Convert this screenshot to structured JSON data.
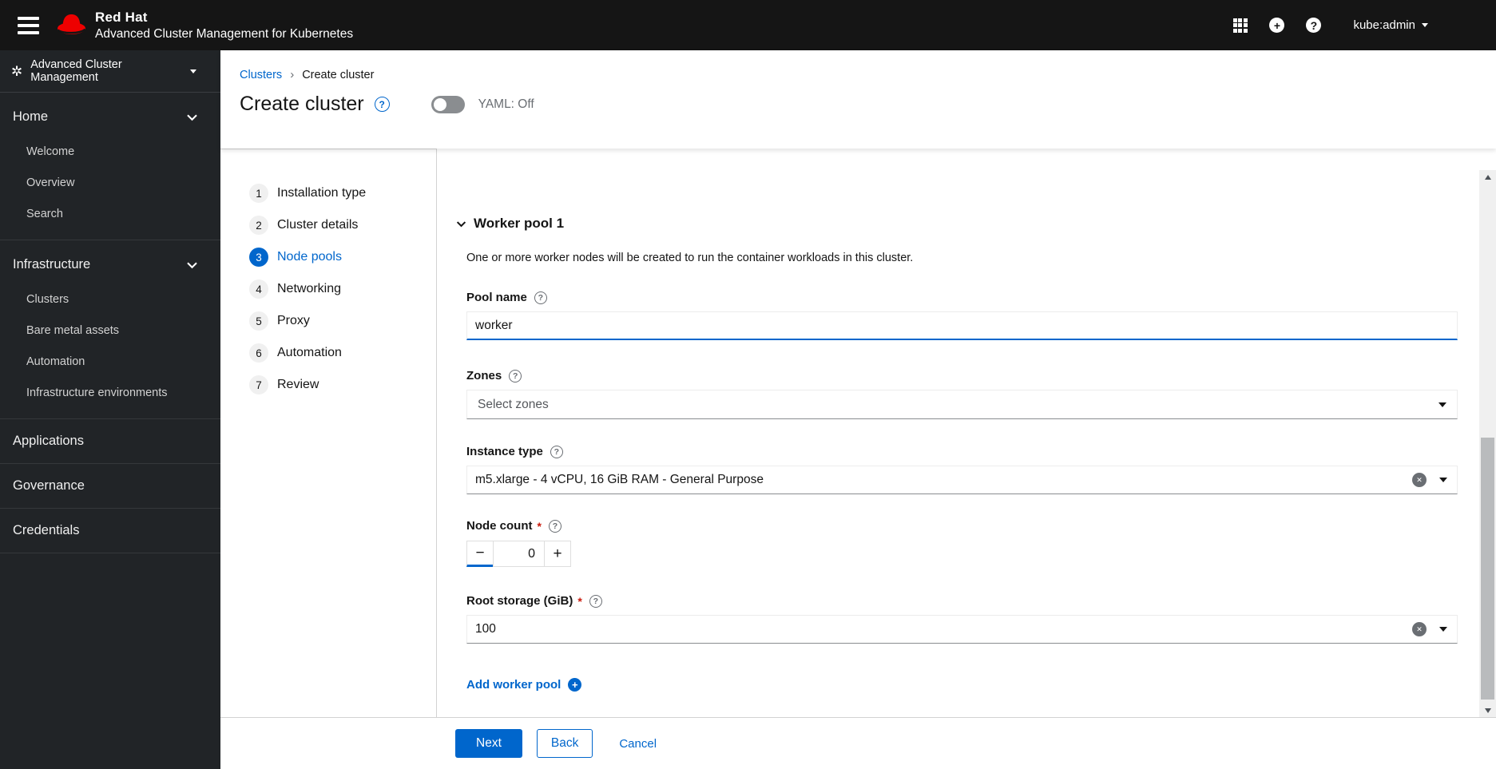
{
  "glyphs": {
    "question": "?",
    "plus": "+",
    "minus": "−",
    "clear": "✕",
    "breadcrumb_separator": "›",
    "perspective_logo": "✲"
  },
  "colors": {
    "brand_red": "#ee0000",
    "accent_blue": "#0066cc",
    "danger_red": "#c9190b",
    "masthead_bg": "#151515",
    "sidebar_bg": "#212427"
  },
  "masthead": {
    "brand_title": "Red Hat",
    "brand_subtitle": "Advanced Cluster Management for Kubernetes",
    "username": "kube:admin"
  },
  "sidebar": {
    "perspective_label": "Advanced Cluster Management",
    "sections": [
      {
        "label": "Home",
        "items": [
          "Welcome",
          "Overview",
          "Search"
        ]
      },
      {
        "label": "Infrastructure",
        "items": [
          "Clusters",
          "Bare metal assets",
          "Automation",
          "Infrastructure environments"
        ]
      },
      {
        "label": "Applications",
        "items": []
      },
      {
        "label": "Governance",
        "items": []
      },
      {
        "label": "Credentials",
        "items": []
      }
    ]
  },
  "breadcrumb": {
    "items": [
      "Clusters",
      "Create cluster"
    ]
  },
  "page_header": {
    "title": "Create cluster",
    "yaml_toggle_label": "YAML: Off"
  },
  "wizard": {
    "steps": [
      {
        "num": "1",
        "label": "Installation type"
      },
      {
        "num": "2",
        "label": "Cluster details"
      },
      {
        "num": "3",
        "label": "Node pools"
      },
      {
        "num": "4",
        "label": "Networking"
      },
      {
        "num": "5",
        "label": "Proxy"
      },
      {
        "num": "6",
        "label": "Automation"
      },
      {
        "num": "7",
        "label": "Review"
      }
    ],
    "active_step": "Node pools"
  },
  "form": {
    "section_title": "Worker pool 1",
    "section_description": "One or more worker nodes will be created to run the container workloads in this cluster.",
    "required_marker": "*",
    "pool_name": {
      "label": "Pool name",
      "value": "worker"
    },
    "zones": {
      "label": "Zones",
      "placeholder": "Select zones"
    },
    "instance_type": {
      "label": "Instance type",
      "value": "m5.xlarge - 4 vCPU, 16 GiB RAM - General Purpose"
    },
    "node_count": {
      "label": "Node count",
      "value": "0"
    },
    "root_storage": {
      "label": "Root storage (GiB)",
      "value": "100"
    },
    "add_worker_pool_label": "Add worker pool"
  },
  "footer": {
    "next": "Next",
    "back": "Back",
    "cancel": "Cancel"
  }
}
